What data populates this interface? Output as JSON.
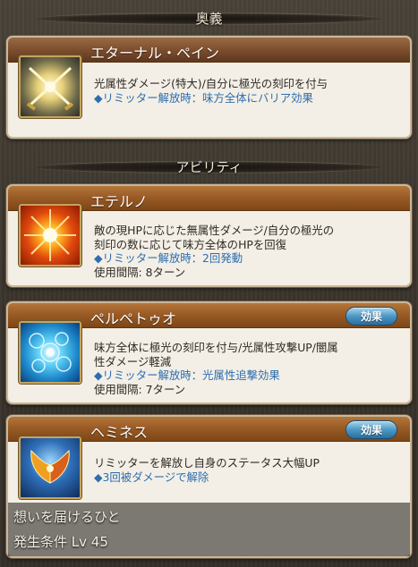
{
  "headers": {
    "ougi": "奥義",
    "abilities": "アビリティ"
  },
  "ougi": {
    "name": "エターナル・ペイン",
    "icon": "crossed-swords-light-icon",
    "desc": "光属性ダメージ(特大)/自分に極光の刻印を付与",
    "limit": "◆リミッター解放時：味方全体にバリア効果"
  },
  "abilities": [
    {
      "name": "エテルノ",
      "icon": "fire-burst-icon",
      "lines": [
        "敵の現HPに応じた無属性ダメージ/自分の極光の",
        "刻印の数に応じて味方全体のHPを回復"
      ],
      "limit": "◆リミッター解放時：2回発動",
      "cooldown": "使用間隔: 8ターン",
      "effect_button": ""
    },
    {
      "name": "ペルペトゥオ",
      "icon": "blue-bubbles-icon",
      "lines": [
        "味方全体に極光の刻印を付与/光属性攻撃UP/闇属",
        "性ダメージ軽減"
      ],
      "limit": "◆リミッター解放時：光属性追撃効果",
      "cooldown": "使用間隔: 7ターン",
      "effect_button": "効果"
    },
    {
      "name": "ヘミネス",
      "icon": "phoenix-wing-icon",
      "lines": [
        "リミッターを解放し自身のステータス大幅UP"
      ],
      "limit": "◆3回被ダメージで解除",
      "cooldown": "",
      "effect_button": "効果"
    }
  ],
  "footer": {
    "line1": "想いを届けるひと",
    "line2": "発生条件 Lv 45"
  }
}
